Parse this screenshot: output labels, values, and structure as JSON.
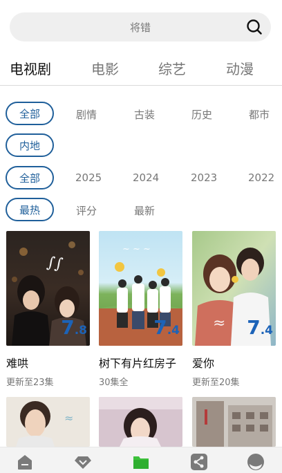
{
  "search": {
    "placeholder_text": "将错"
  },
  "tabs": [
    {
      "label": "电视剧",
      "active": true
    },
    {
      "label": "电影",
      "active": false
    },
    {
      "label": "综艺",
      "active": false
    },
    {
      "label": "动漫",
      "active": false
    }
  ],
  "filters": {
    "genre": {
      "selected": "全部",
      "options": [
        "剧情",
        "古装",
        "历史",
        "都市"
      ]
    },
    "region": {
      "selected": "内地"
    },
    "year": {
      "selected": "全部",
      "options": [
        "2025",
        "2024",
        "2023",
        "2022"
      ]
    },
    "sort": {
      "selected": "最热",
      "options": [
        "评分",
        "最新"
      ]
    }
  },
  "cards": [
    {
      "title": "难哄",
      "subtitle": "更新至23集",
      "score_int": "7",
      "score_dec": ".8"
    },
    {
      "title": "树下有片红房子",
      "subtitle": "30集全",
      "score_int": "7",
      "score_dec": ".4"
    },
    {
      "title": "爱你",
      "subtitle": "更新至20集",
      "score_int": "7",
      "score_dec": ".4"
    }
  ],
  "bottom_nav": [
    {
      "icon": "home-icon",
      "active": false
    },
    {
      "icon": "diamond-icon",
      "active": false
    },
    {
      "icon": "folder-icon",
      "active": true
    },
    {
      "icon": "share-icon",
      "active": false
    },
    {
      "icon": "profile-icon",
      "active": false
    }
  ],
  "colors": {
    "accent": "#1f5f9a",
    "score": "#1c63b8",
    "active_nav": "#3cc13b",
    "inactive_nav": "#7a7a7a"
  }
}
